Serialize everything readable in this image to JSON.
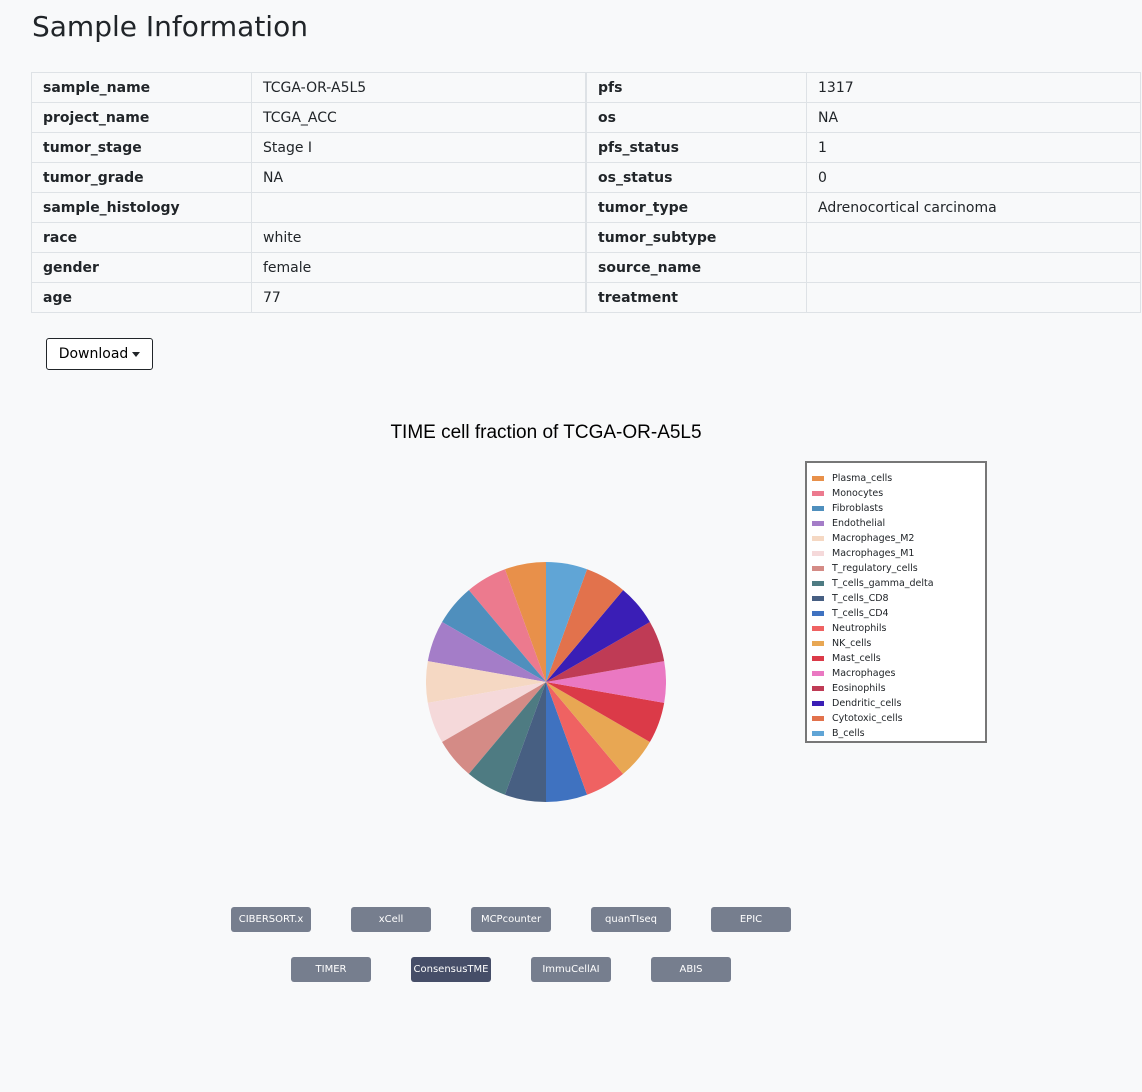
{
  "page": {
    "title": "Sample Information"
  },
  "info_left": [
    {
      "key": "sample_name",
      "value": "TCGA-OR-A5L5"
    },
    {
      "key": "project_name",
      "value": "TCGA_ACC"
    },
    {
      "key": "tumor_stage",
      "value": "Stage I"
    },
    {
      "key": "tumor_grade",
      "value": "NA"
    },
    {
      "key": "sample_histology",
      "value": ""
    },
    {
      "key": "race",
      "value": "white"
    },
    {
      "key": "gender",
      "value": "female"
    },
    {
      "key": "age",
      "value": "77"
    }
  ],
  "info_right": [
    {
      "key": "pfs",
      "value": "1317"
    },
    {
      "key": "os",
      "value": "NA"
    },
    {
      "key": "pfs_status",
      "value": "1"
    },
    {
      "key": "os_status",
      "value": "0"
    },
    {
      "key": "tumor_type",
      "value": "Adrenocortical carcinoma"
    },
    {
      "key": "tumor_subtype",
      "value": ""
    },
    {
      "key": "source_name",
      "value": ""
    },
    {
      "key": "treatment",
      "value": ""
    }
  ],
  "download": {
    "label": "Download"
  },
  "chart_data": {
    "type": "pie",
    "title": "TIME cell fraction of TCGA-OR-A5L5",
    "legend_position": "right",
    "series": [
      {
        "name": "Plasma_cells",
        "value": 1,
        "color": "#e8904a"
      },
      {
        "name": "Monocytes",
        "value": 1,
        "color": "#ec7a8e"
      },
      {
        "name": "Fibroblasts",
        "value": 1,
        "color": "#4f8fbd"
      },
      {
        "name": "Endothelial",
        "value": 1,
        "color": "#a47dc8"
      },
      {
        "name": "Macrophages_M2",
        "value": 1,
        "color": "#f5d8c3"
      },
      {
        "name": "Macrophages_M1",
        "value": 1,
        "color": "#f5d9da"
      },
      {
        "name": "T_regulatory_cells",
        "value": 1,
        "color": "#d48b86"
      },
      {
        "name": "T_cells_gamma_delta",
        "value": 1,
        "color": "#4e7b82"
      },
      {
        "name": "T_cells_CD8",
        "value": 1,
        "color": "#475f82"
      },
      {
        "name": "T_cells_CD4",
        "value": 1,
        "color": "#3f72c0"
      },
      {
        "name": "Neutrophils",
        "value": 1,
        "color": "#ef6262"
      },
      {
        "name": "NK_cells",
        "value": 1,
        "color": "#e8a753"
      },
      {
        "name": "Mast_cells",
        "value": 1,
        "color": "#db3a48"
      },
      {
        "name": "Macrophages",
        "value": 1,
        "color": "#ea78c2"
      },
      {
        "name": "Eosinophils",
        "value": 1,
        "color": "#bf3b55"
      },
      {
        "name": "Dendritic_cells",
        "value": 1,
        "color": "#3a1eb6"
      },
      {
        "name": "Cytotoxic_cells",
        "value": 1,
        "color": "#e2724c"
      },
      {
        "name": "B_cells",
        "value": 1,
        "color": "#60a5d6"
      }
    ]
  },
  "methods": {
    "row1": [
      "CIBERSORT.x",
      "xCell",
      "MCPcounter",
      "quanTIseq",
      "EPIC"
    ],
    "row2": [
      "TIMER",
      "ConsensusTME",
      "ImmuCellAI",
      "ABIS"
    ],
    "active": "ConsensusTME"
  }
}
